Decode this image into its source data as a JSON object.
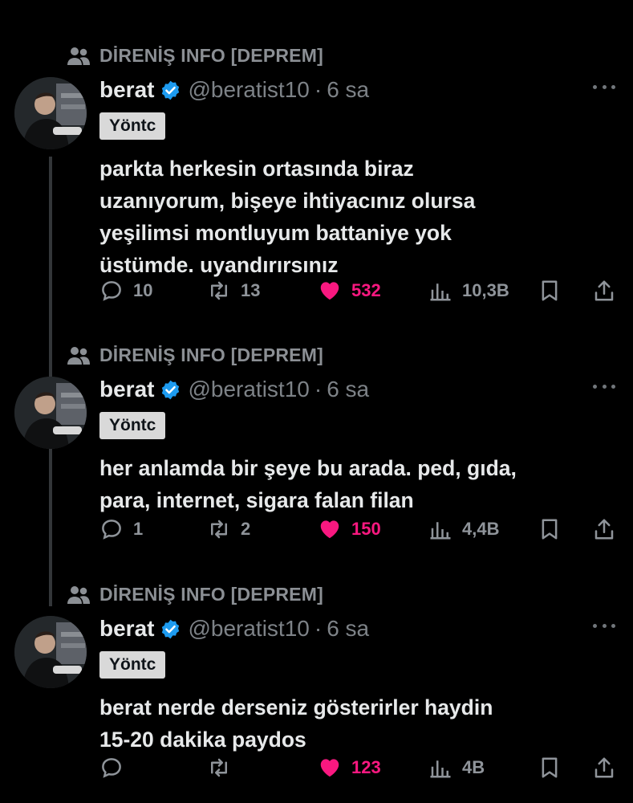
{
  "community": "DİRENİŞ INFO [DEPREM]",
  "tweets": [
    {
      "name": "berat",
      "handle": "@beratist10",
      "separator": "·",
      "time": "6 sa",
      "label": "Yöntc",
      "text_lines": [
        "parkta herkesin ortasında biraz",
        "uzanıyorum, bişeye ihtiyacınız olursa",
        "yeşilimsi montluyum battaniye yok",
        "üstümde. uyandırırsınız"
      ],
      "replies": "10",
      "retweets": "13",
      "likes": "532",
      "views": "10,3B"
    },
    {
      "name": "berat",
      "handle": "@beratist10",
      "separator": "·",
      "time": "6 sa",
      "label": "Yöntc",
      "text_lines": [
        "her anlamda bir şeye bu arada. ped, gıda,",
        "para, internet, sigara falan filan"
      ],
      "replies": "1",
      "retweets": "2",
      "likes": "150",
      "views": "4,4B"
    },
    {
      "name": "berat",
      "handle": "@beratist10",
      "separator": "·",
      "time": "6 sa",
      "label": "Yöntc",
      "text_lines": [
        "berat nerde derseniz gösterirler haydin",
        "15-20 dakika paydos"
      ],
      "replies": "",
      "retweets": "",
      "likes": "123",
      "views": "4B"
    }
  ],
  "icons": {
    "community": "people-icon",
    "verified": "verified-badge-icon",
    "more": "more-icon",
    "reply": "reply-icon",
    "retweet": "retweet-icon",
    "like": "heart-icon",
    "views": "views-icon",
    "bookmark": "bookmark-icon",
    "share": "share-icon"
  },
  "colors": {
    "background": "#000000",
    "text": "#e7e9ea",
    "muted": "#7d8287",
    "like": "#f91880",
    "verified": "#1d9bf0",
    "label_bg": "#d9d9d9"
  }
}
